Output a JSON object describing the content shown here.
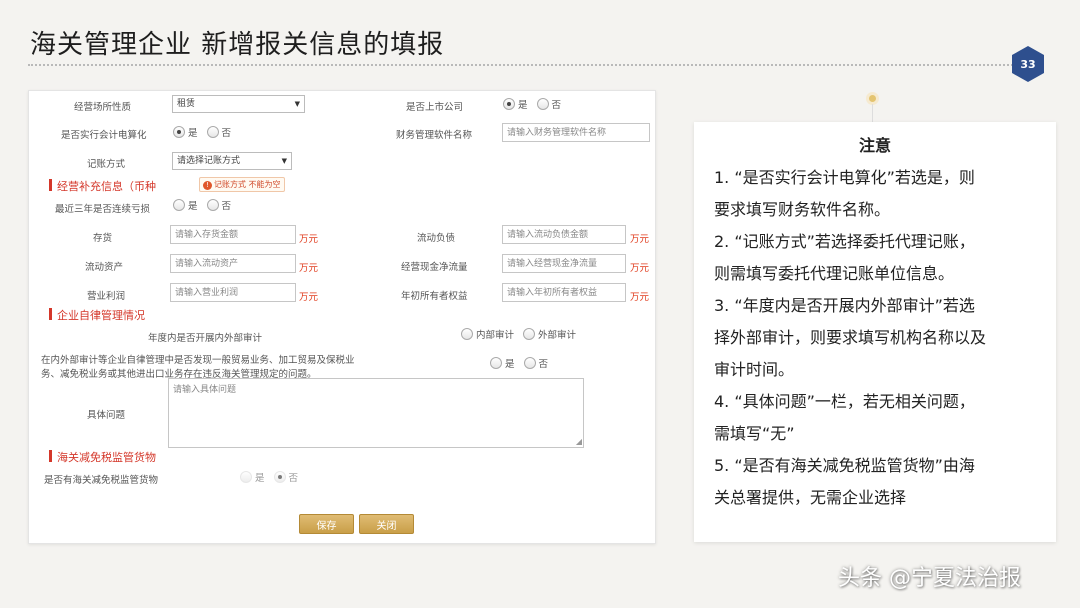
{
  "slide": {
    "title": "海关管理企业  新增报关信息的填报",
    "page_number": "33",
    "watermark": "头条 @宁夏法治报"
  },
  "form": {
    "business_premises_nature_label": "经营场所性质",
    "business_premises_nature_value": "租赁",
    "listed_company_label": "是否上市公司",
    "listed_company_options": [
      "是",
      "否"
    ],
    "listed_company_selected": "是",
    "accounting_computerized_label": "是否实行会计电算化",
    "accounting_computerized_options": [
      "是",
      "否"
    ],
    "accounting_computerized_selected": "是",
    "finance_software_label": "财务管理软件名称",
    "finance_software_placeholder": "请输入财务管理软件名称",
    "bookkeeping_label": "记账方式",
    "bookkeeping_value": "请选择记账方式",
    "bookkeeping_error": "记账方式 不能为空",
    "section_business": "经营补充信息（币种",
    "consecutive_loss_label": "最近三年是否连续亏损",
    "consecutive_loss_options": [
      "是",
      "否"
    ],
    "fields": [
      {
        "label": "存货",
        "placeholder": "请输入存货金额",
        "unit": "万元"
      },
      {
        "label": "流动负债",
        "placeholder": "请输入流动负债金额",
        "unit": "万元"
      },
      {
        "label": "流动资产",
        "placeholder": "请输入流动资产",
        "unit": "万元"
      },
      {
        "label": "经营现金净流量",
        "placeholder": "请输入经营现金净流量",
        "unit": "万元"
      },
      {
        "label": "营业利润",
        "placeholder": "请输入营业利润",
        "unit": "万元"
      },
      {
        "label": "年初所有者权益",
        "placeholder": "请输入年初所有者权益",
        "unit": "万元"
      }
    ],
    "section_self_discipline": "企业自律管理情况",
    "audit_label": "年度内是否开展内外部审计",
    "audit_options": [
      "内部审计",
      "外部审计"
    ],
    "violation_question_line1": "在内外部审计等企业自律管理中是否发现一般贸易业务、加工贸易及保税业",
    "violation_question_line2": "务、减免税业务或其他进出口业务存在违反海关管理规定的问题。",
    "violation_options": [
      "是",
      "否"
    ],
    "specific_issue_label": "具体问题",
    "specific_issue_placeholder": "请输入具体问题",
    "section_tax_exempt": "海关减免税监管货物",
    "tax_exempt_goods_label": "是否有海关减免税监管货物",
    "tax_exempt_goods_options": [
      "是",
      "否"
    ],
    "tax_exempt_goods_selected": "否",
    "save_label": "保存",
    "close_label": "关闭"
  },
  "notes": {
    "title": "注意",
    "items": [
      "1. “是否实行会计电算化”若选是，则",
      "要求填写财务软件名称。",
      "2. “记账方式”若选择委托代理记账，",
      "则需填写委托代理记账单位信息。",
      "3. “年度内是否开展内外部审计”若选",
      "择外部审计，则要求填写机构名称以及",
      "审计时间。",
      "4. “具体问题”一栏，若无相关问题，",
      "需填写“无”",
      "5. “是否有海关减免税监管货物”由海",
      "关总署提供，无需企业选择"
    ]
  },
  "colors": {
    "accent_red": "#d4372a",
    "button_gold": "#c99f48",
    "badge_blue": "#2e4f8e"
  }
}
